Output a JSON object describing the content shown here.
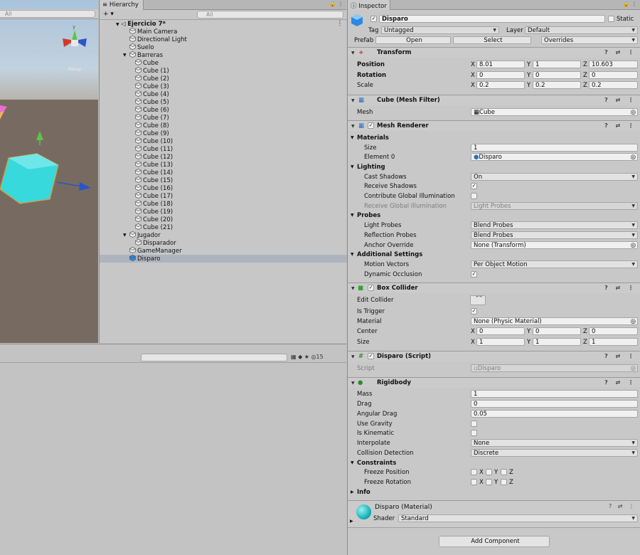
{
  "scene": {
    "search_placeholder": "All",
    "persp_label": "Persp",
    "axis_y": "y"
  },
  "hierarchy": {
    "tab": "Hierarchy",
    "add_label": "+ ▾",
    "search_placeholder": "All",
    "scene_name": "Ejercicio 7*",
    "items": [
      "Main Camera",
      "Directional Light",
      "Suelo",
      "Barreras",
      "Cube",
      "Cube (1)",
      "Cube (2)",
      "Cube (3)",
      "Cube (4)",
      "Cube (5)",
      "Cube (6)",
      "Cube (7)",
      "Cube (8)",
      "Cube (9)",
      "Cube (10)",
      "Cube (11)",
      "Cube (12)",
      "Cube (13)",
      "Cube (14)",
      "Cube (15)",
      "Cube (16)",
      "Cube (17)",
      "Cube (18)",
      "Cube (19)",
      "Cube (20)",
      "Cube (21)",
      "Jugador",
      "Disparador",
      "GameManager",
      "Disparo"
    ]
  },
  "bottom": {
    "count": "15"
  },
  "inspector": {
    "tab": "Inspector",
    "object_name": "Disparo",
    "static_label": "Static",
    "tag_label": "Tag",
    "tag_value": "Untagged",
    "layer_label": "Layer",
    "layer_value": "Default",
    "prefab_label": "Prefab",
    "open_label": "Open",
    "select_label": "Select",
    "overrides_label": "Overrides",
    "transform": {
      "title": "Transform",
      "position_label": "Position",
      "rotation_label": "Rotation",
      "scale_label": "Scale",
      "px": "8.01",
      "py": "1",
      "pz": "10.603",
      "rx": "0",
      "ry": "0",
      "rz": "0",
      "sx": "0.2",
      "sy": "0.2",
      "sz": "0.2"
    },
    "mesh_filter": {
      "title": "Cube (Mesh Filter)",
      "mesh_label": "Mesh",
      "mesh_value": "Cube"
    },
    "mesh_renderer": {
      "title": "Mesh Renderer",
      "materials": "Materials",
      "size_label": "Size",
      "size_value": "1",
      "element0_label": "Element 0",
      "element0_value": "Disparo",
      "lighting": "Lighting",
      "cast_shadows": "Cast Shadows",
      "cast_shadows_value": "On",
      "receive_shadows": "Receive Shadows",
      "contribute_gi": "Contribute Global Illumination",
      "receive_gi": "Receive Global Illumination",
      "receive_gi_value": "Light Probes",
      "probes": "Probes",
      "light_probes": "Light Probes",
      "light_probes_value": "Blend Probes",
      "reflection_probes": "Reflection Probes",
      "reflection_probes_value": "Blend Probes",
      "anchor_override": "Anchor Override",
      "anchor_override_value": "None (Transform)",
      "additional": "Additional Settings",
      "motion_vectors": "Motion Vectors",
      "motion_vectors_value": "Per Object Motion",
      "dynamic_occlusion": "Dynamic Occlusion"
    },
    "box_collider": {
      "title": "Box Collider",
      "edit_collider": "Edit Collider",
      "is_trigger": "Is Trigger",
      "material_label": "Material",
      "material_value": "None (Physic Material)",
      "center_label": "Center",
      "cx": "0",
      "cy": "0",
      "cz": "0",
      "size_label": "Size",
      "sx": "1",
      "sy": "1",
      "sz": "1"
    },
    "script": {
      "title": "Disparo (Script)",
      "script_label": "Script",
      "script_value": "Disparo"
    },
    "rigidbody": {
      "title": "Rigidbody",
      "mass_label": "Mass",
      "mass": "1",
      "drag_label": "Drag",
      "drag": "0",
      "angular_drag_label": "Angular Drag",
      "angular_drag": "0.05",
      "use_gravity": "Use Gravity",
      "is_kinematic": "Is Kinematic",
      "interpolate_label": "Interpolate",
      "interpolate": "None",
      "collision_label": "Collision Detection",
      "collision": "Discrete",
      "constraints": "Constraints",
      "freeze_position": "Freeze Position",
      "freeze_rotation": "Freeze Rotation",
      "x": "X",
      "y": "Y",
      "z": "Z",
      "info": "Info"
    },
    "material": {
      "title": "Disparo (Material)",
      "shader_label": "Shader",
      "shader_value": "Standard"
    },
    "add_component": "Add Component",
    "axis_x": "X",
    "axis_y": "Y",
    "axis_z": "Z"
  }
}
